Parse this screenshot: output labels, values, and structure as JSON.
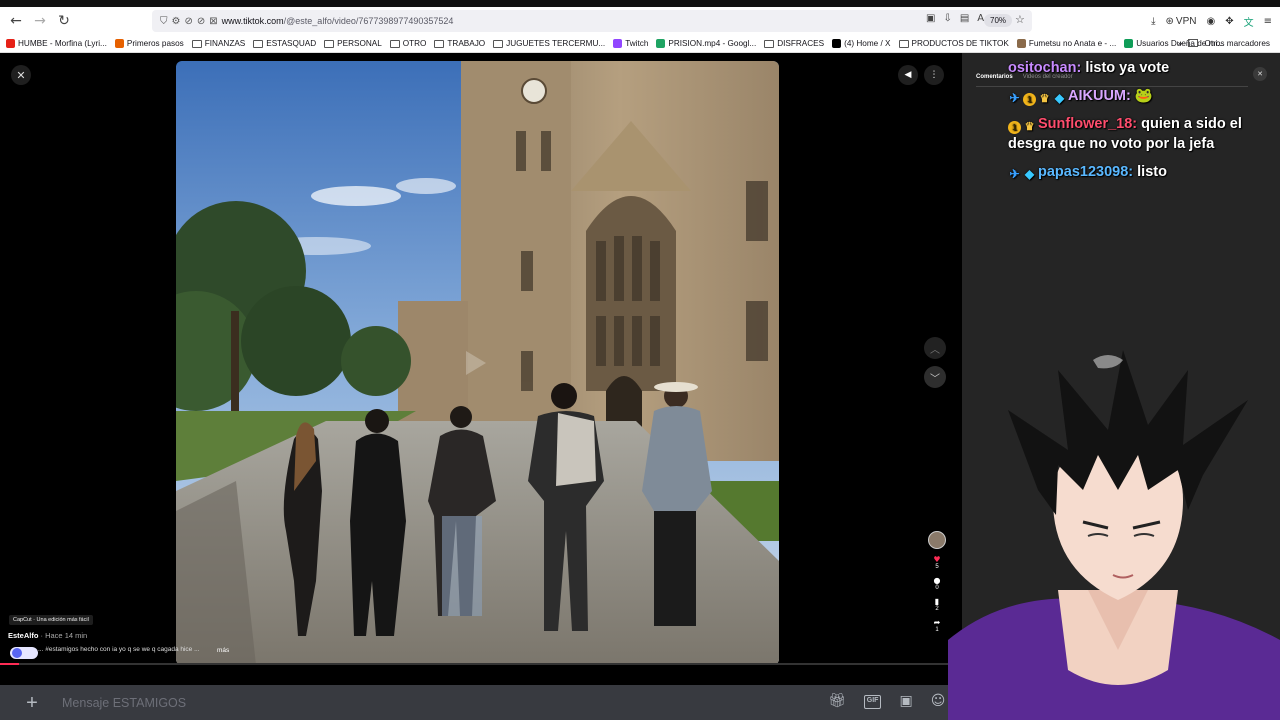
{
  "browser": {
    "url_domain": "www.tiktok.com",
    "url_path": "/@este_alfo/video/7677398977490357524",
    "zoom": "70%",
    "vpn_label": "VPN",
    "bookmarks": [
      {
        "label": "HUMBE - Morfina (Lyri...",
        "kind": "youtube"
      },
      {
        "label": "Primeros pasos",
        "kind": "firefox"
      },
      {
        "label": "FINANZAS",
        "kind": "folder"
      },
      {
        "label": "ESTASQUAD",
        "kind": "folder"
      },
      {
        "label": "PERSONAL",
        "kind": "folder"
      },
      {
        "label": "OTRO",
        "kind": "folder"
      },
      {
        "label": "TRABAJO",
        "kind": "folder"
      },
      {
        "label": "JUGUETES TERCERMU...",
        "kind": "folder"
      },
      {
        "label": "Twitch",
        "kind": "twitch"
      },
      {
        "label": "PRISION.mp4 - Googl...",
        "kind": "drive"
      },
      {
        "label": "DISFRACES",
        "kind": "folder"
      },
      {
        "label": "(4) Home / X",
        "kind": "x"
      },
      {
        "label": "PRODUCTOS DE TIKTOK",
        "kind": "folder"
      },
      {
        "label": "Fumetsu no Anata e - ...",
        "kind": "site"
      },
      {
        "label": "Usuarios Dueña de mi...",
        "kind": "sheets"
      }
    ],
    "other_bookmarks": "Otros marcadores"
  },
  "video": {
    "author": "EsteAlfo",
    "time": "· Hace 14 min",
    "capcut_label": "CapCut · Una edición más fácil",
    "description": "... #estamigos hecho con ia yo q se we q cagada hice ...",
    "more_label": "más",
    "progress": 0.02,
    "counts": {
      "likes": "5",
      "comments": "0",
      "saves": "2",
      "shares": "1"
    }
  },
  "panel": {
    "tabs": [
      "Comentarios",
      "Videos del creador"
    ]
  },
  "chat": [
    {
      "user": "ositochan:",
      "color": "u-purple",
      "badges": [],
      "text": "listo ya vote"
    },
    {
      "user": "AIKUUM:",
      "color": "u-cyan",
      "badges": [
        "sword",
        "one",
        "crown",
        "cube"
      ],
      "text": "🐸"
    },
    {
      "user": "Sunflower_18:",
      "color": "u-red",
      "badges": [
        "one",
        "crown"
      ],
      "text": "quien a sido el desgra que no voto por la jefa"
    },
    {
      "user": "papas123098:",
      "color": "u-blue",
      "badges": [
        "sword",
        "cube"
      ],
      "text": "listo"
    }
  ],
  "composer": {
    "placeholder": "Mensaje ESTAMIGOS"
  },
  "icons": {
    "back": "arrow-left-icon",
    "forward": "arrow-right-icon",
    "reload": "reload-icon",
    "gift": "gift-icon",
    "gif": "gif-icon",
    "sticker": "sticker-icon",
    "emoji": "emoji-icon"
  }
}
